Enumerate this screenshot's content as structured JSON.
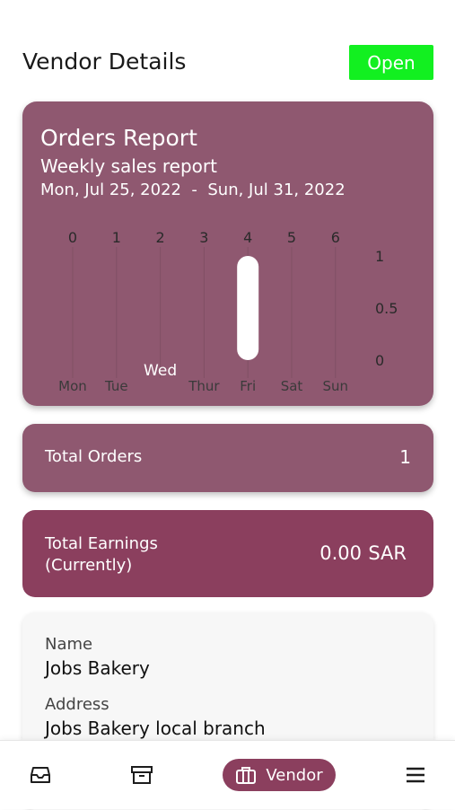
{
  "header": {
    "title": "Vendor Details",
    "status": "Open",
    "status_color": "#12f020"
  },
  "report": {
    "title": "Orders Report",
    "subtitle": "Weekly sales report",
    "date_range": "Mon, Jul 25, 2022  -  Sun, Jul 31, 2022",
    "card_color": "#8f5870"
  },
  "chart_data": {
    "type": "bar",
    "top_axis_ticks": [
      "0",
      "1",
      "2",
      "3",
      "4",
      "5",
      "6"
    ],
    "categories": [
      "Mon",
      "Tue",
      "Wed",
      "Thur",
      "Fri",
      "Sat",
      "Sun"
    ],
    "highlighted_category": "Wed",
    "values": [
      0,
      0,
      0,
      0,
      1,
      0,
      0
    ],
    "y_ticks": [
      "1",
      "0.5",
      "0"
    ],
    "ylim": [
      0,
      1
    ],
    "bar_color": "#ffffff",
    "grid": true
  },
  "summary": {
    "orders_label": "Total Orders",
    "orders_value": "1",
    "earnings_label_line1": "Total Earnings",
    "earnings_label_line2": "(Currently)",
    "earnings_value": "0.00",
    "earnings_currency": "SAR"
  },
  "vendor": {
    "name_label": "Name",
    "name_value": "Jobs Bakery",
    "address_label": "Address",
    "address_value": "Jobs Bakery local branch"
  },
  "nav": {
    "vendor_label": "Vendor",
    "items": [
      {
        "icon": "inbox-icon"
      },
      {
        "icon": "archive-icon"
      },
      {
        "icon": "store-icon"
      },
      {
        "icon": "menu-icon"
      }
    ],
    "accent": "#8b3f5e"
  }
}
